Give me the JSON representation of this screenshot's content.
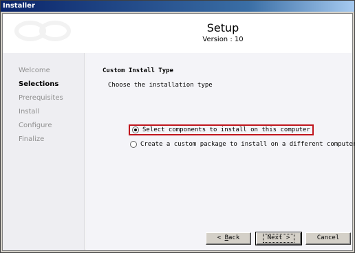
{
  "window": {
    "title": "Installer"
  },
  "header": {
    "title": "Setup",
    "version": "Version : 10"
  },
  "nav": {
    "items": [
      {
        "label": "Welcome",
        "active": false
      },
      {
        "label": "Selections",
        "active": true
      },
      {
        "label": "Prerequisites",
        "active": false
      },
      {
        "label": "Install",
        "active": false
      },
      {
        "label": "Configure",
        "active": false
      },
      {
        "label": "Finalize",
        "active": false
      }
    ]
  },
  "main": {
    "section_title": "Custom Install Type",
    "section_subtitle": "Choose the installation type",
    "options": [
      {
        "label": "Select components to install on this computer",
        "selected": true
      },
      {
        "label": "Create a custom package to install on a different computer",
        "selected": false
      }
    ]
  },
  "buttons": {
    "back_prefix": "< ",
    "back_hotkey": "B",
    "back_suffix": "ack",
    "next_label": "Next >",
    "cancel_label": "Cancel"
  },
  "colors": {
    "titlebar": "#0a246a",
    "highlight_border": "#c0141c",
    "nav_background": "#eeeef2"
  }
}
